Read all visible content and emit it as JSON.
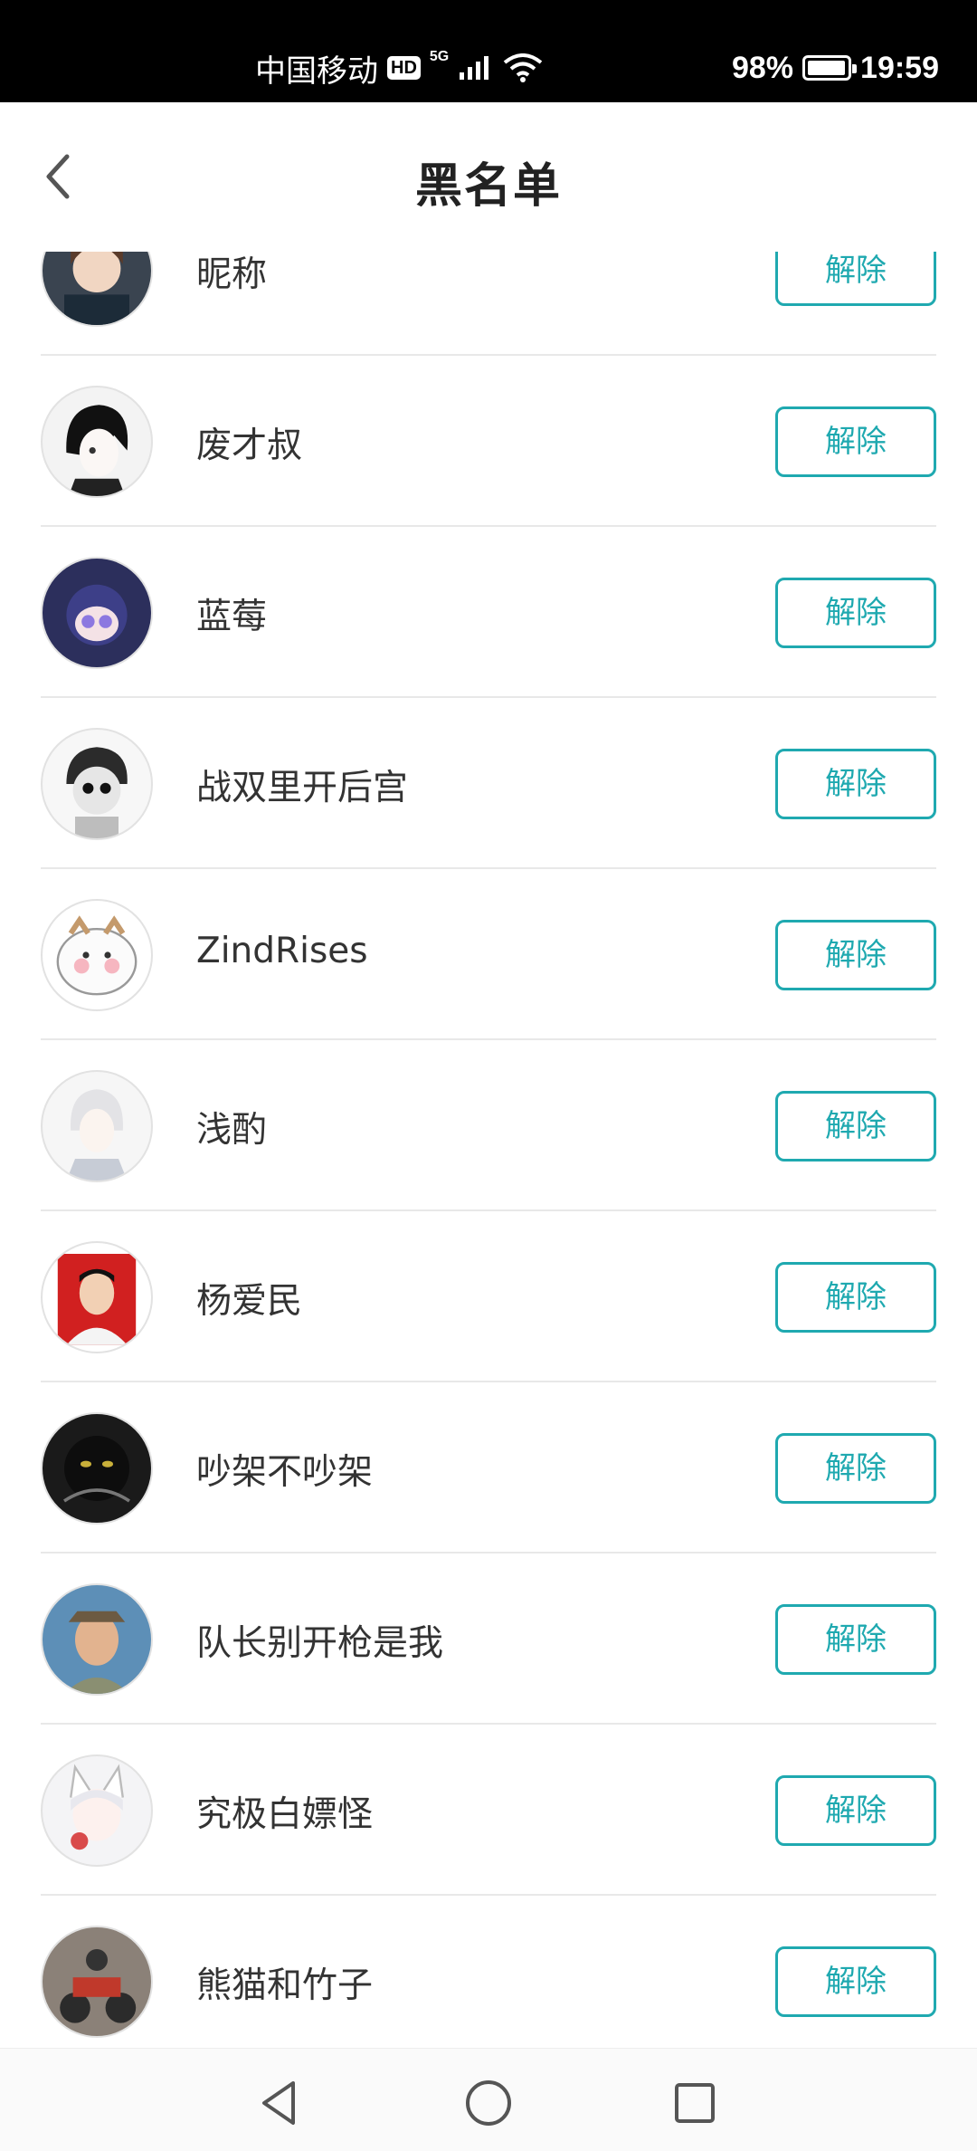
{
  "status_bar": {
    "carrier": "中国移动",
    "hd": "HD",
    "network": "5G",
    "battery": "98%",
    "battery_level": 0.98,
    "time": "19:59"
  },
  "header": {
    "title": "黑名单",
    "back_icon": "chevron-left-icon"
  },
  "list": {
    "action_label": "解除",
    "accent_color": "#1fa9b0",
    "items": [
      {
        "name": "昵称",
        "avatar": "anime-girl-avatar"
      },
      {
        "name": "废才叔",
        "avatar": "anime-boy-avatar"
      },
      {
        "name": "蓝莓",
        "avatar": "anime-chibi-avatar"
      },
      {
        "name": "战双里开后宫",
        "avatar": "sketch-boy-avatar"
      },
      {
        "name": "ZindRises",
        "avatar": "cartoon-cat-avatar"
      },
      {
        "name": "浅酌",
        "avatar": "white-hair-avatar"
      },
      {
        "name": "杨爱民",
        "avatar": "photo-red-background-avatar"
      },
      {
        "name": "吵架不吵架",
        "avatar": "black-cat-avatar"
      },
      {
        "name": "队长别开枪是我",
        "avatar": "man-photo-avatar"
      },
      {
        "name": "究极白嫖怪",
        "avatar": "fox-girl-avatar"
      },
      {
        "name": "熊猫和竹子",
        "avatar": "motorbike-avatar"
      }
    ]
  },
  "nav_bar": {
    "back": "triangle-back-icon",
    "home": "circle-home-icon",
    "recents": "square-recents-icon"
  }
}
